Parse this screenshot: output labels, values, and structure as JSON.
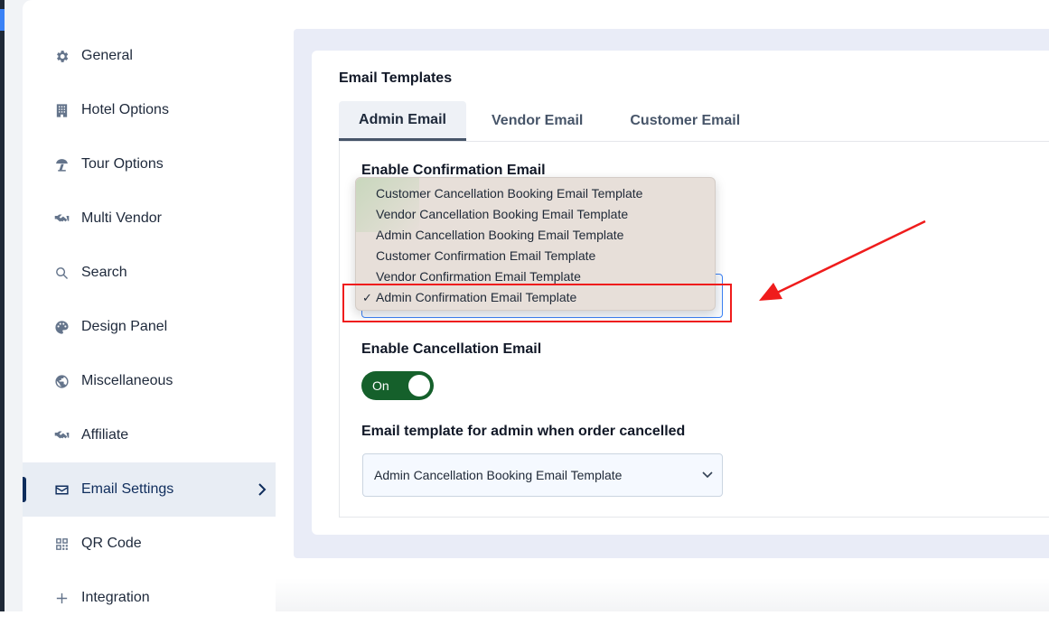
{
  "sidebar": {
    "items": [
      {
        "label": "General",
        "icon": "gear-icon"
      },
      {
        "label": "Hotel Options",
        "icon": "building-icon"
      },
      {
        "label": "Tour Options",
        "icon": "umbrella-beach-icon"
      },
      {
        "label": "Multi Vendor",
        "icon": "handshake-icon"
      },
      {
        "label": "Search",
        "icon": "search-icon"
      },
      {
        "label": "Design Panel",
        "icon": "palette-icon"
      },
      {
        "label": "Miscellaneous",
        "icon": "globe-icon"
      },
      {
        "label": "Affiliate",
        "icon": "handshake-icon"
      },
      {
        "label": "Email Settings",
        "icon": "envelope-icon",
        "active": true
      },
      {
        "label": "QR Code",
        "icon": "qr-code-icon"
      },
      {
        "label": "Integration",
        "icon": "plus-icon"
      }
    ]
  },
  "section": {
    "title": "Email Templates",
    "tabs": [
      {
        "label": "Admin Email",
        "active": true
      },
      {
        "label": "Vendor Email"
      },
      {
        "label": "Customer Email"
      }
    ]
  },
  "confirmation": {
    "label": "Enable Confirmation Email",
    "dropdown_options": [
      "Customer Cancellation Booking Email Template",
      "Vendor Cancellation Booking Email Template",
      "Admin Cancellation Booking Email Template",
      "Customer Confirmation Email Template",
      "Vendor Confirmation Email Template",
      "Admin Confirmation Email Template"
    ],
    "selected_index": 5,
    "check_mark": "✓"
  },
  "cancellation": {
    "label": "Enable Cancellation Email",
    "toggle_text": "On",
    "template_label": "Email template for admin when order cancelled",
    "template_value": "Admin Cancellation Booking Email Template"
  },
  "colors": {
    "accent_navy": "#0f2d5c",
    "toggle_green": "#15602b",
    "annotation_red": "#ef1c1c",
    "focus_blue": "#3b82f6"
  }
}
